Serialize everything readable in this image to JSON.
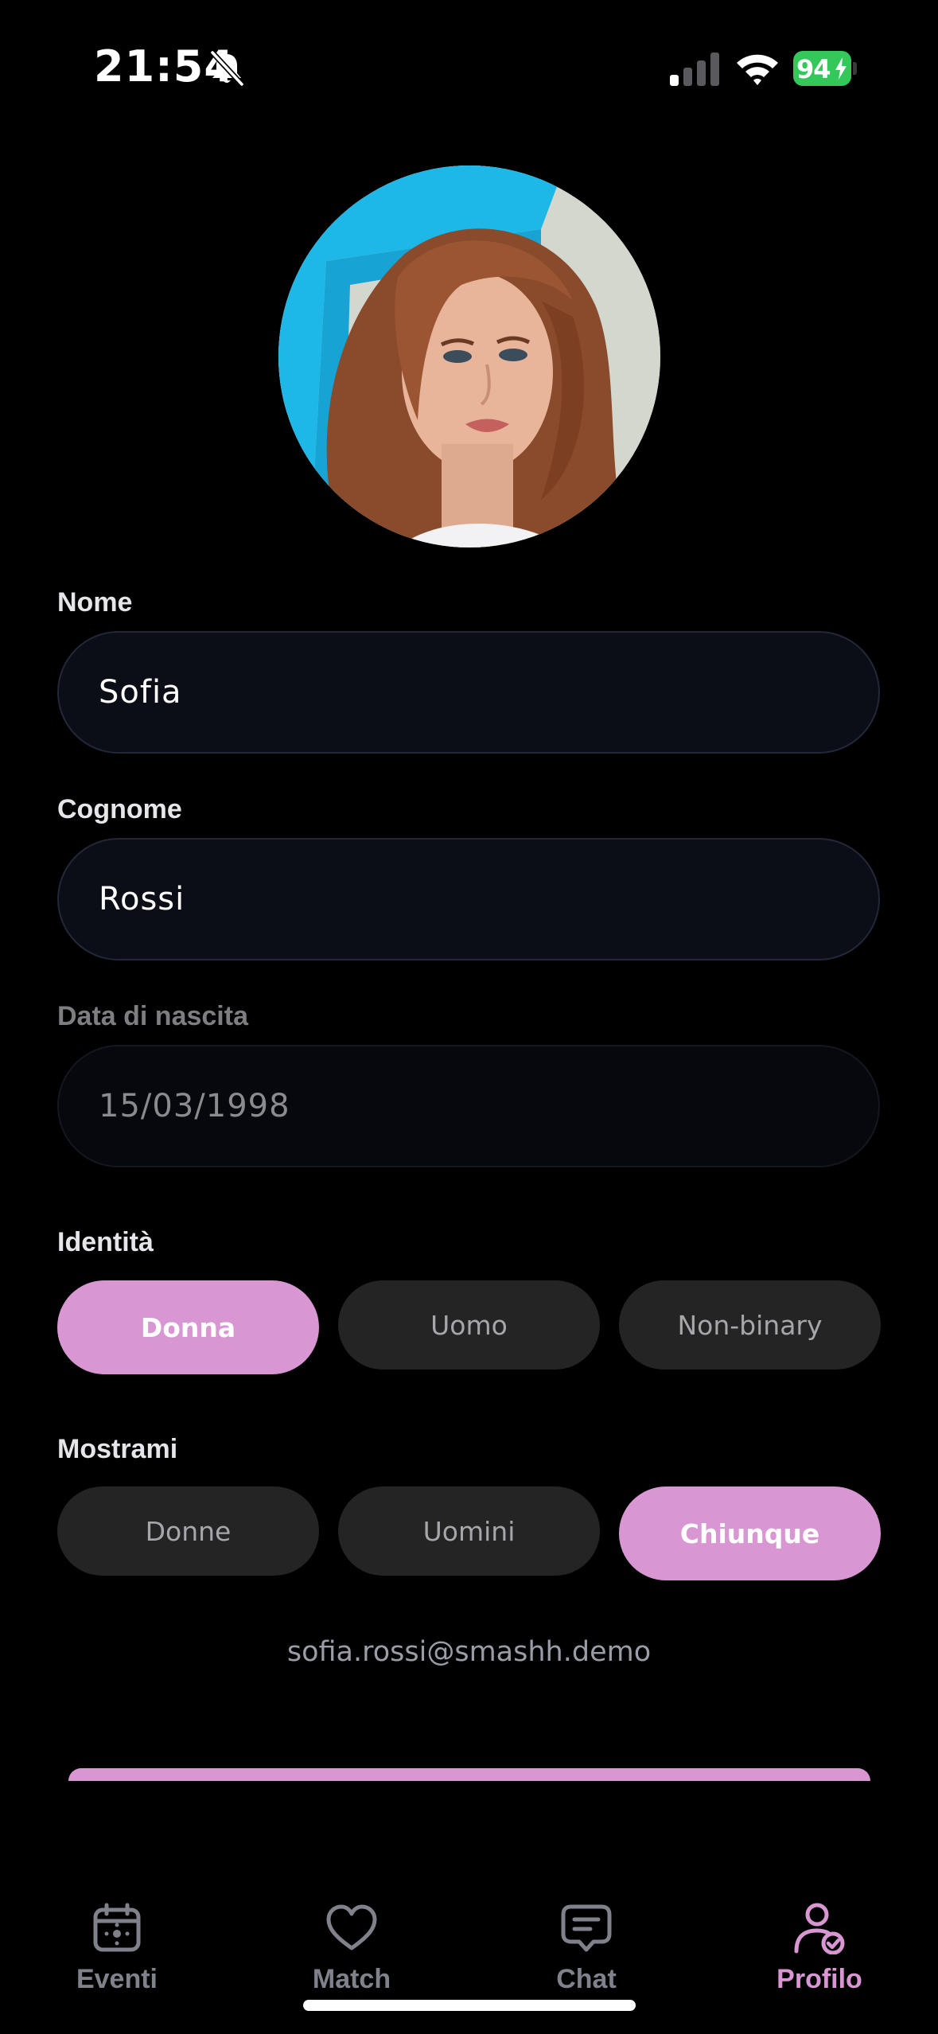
{
  "status_bar": {
    "time": "21:54",
    "battery": "94"
  },
  "profile": {
    "avatar_alt": "Sofia"
  },
  "form": {
    "nome_label": "Nome",
    "nome_value": "Sofia",
    "cognome_label": "Cognome",
    "cognome_value": "Rossi",
    "nascita_label": "Data di nascita",
    "nascita_value": "15/03/1998",
    "identita_label": "Identità",
    "identita_options": [
      "Donna",
      "Uomo",
      "Non-binary"
    ],
    "identita_selected": "Donna",
    "mostrami_label": "Mostrami",
    "mostrami_options": [
      "Donne",
      "Uomini",
      "Chiunque"
    ],
    "mostrami_selected": "Chiunque",
    "email": "sofia.rossi@smashh.demo"
  },
  "tabs": [
    {
      "label": "Eventi",
      "icon": "calendar-icon"
    },
    {
      "label": "Match",
      "icon": "heart-icon"
    },
    {
      "label": "Chat",
      "icon": "chat-icon"
    },
    {
      "label": "Profilo",
      "icon": "profile-check-icon"
    }
  ],
  "active_tab": "Profilo",
  "colors": {
    "accent": "#d896d2",
    "background": "#000000",
    "pill_inactive": "#242424",
    "battery": "#34c759"
  }
}
